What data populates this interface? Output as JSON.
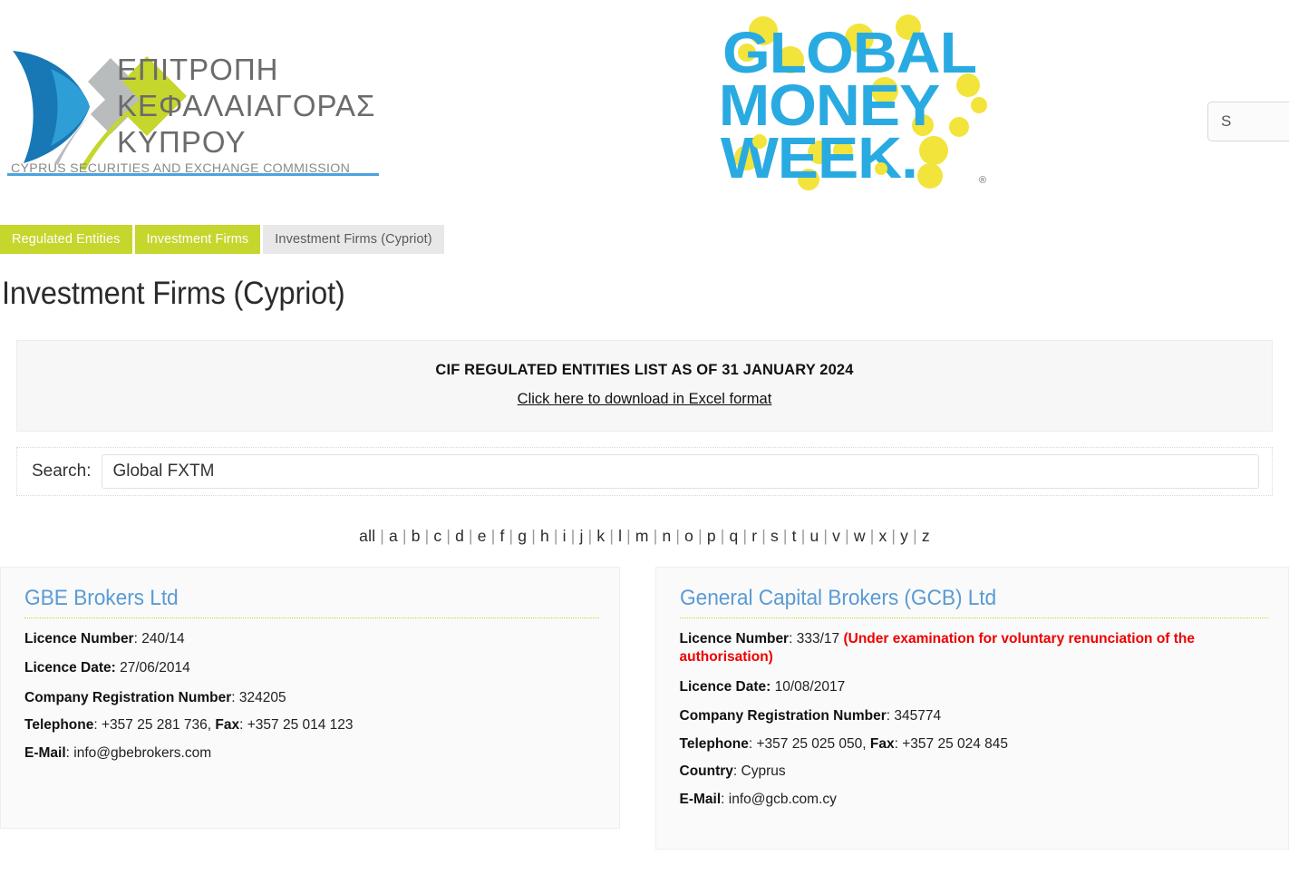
{
  "header": {
    "cysec_logo_alt": "ΕΠΙΤΡΟΠΗ ΚΕΦΑΛΑΙΑΓΟΡΑΣ ΚΥΠΡΟΥ",
    "cysec_line1": "ΕΠΙΤΡΟΠΗ",
    "cysec_line2": "ΚΕΦΑΛΑΙΑΓΟΡΑΣ",
    "cysec_line3": "ΚΥΠΡΟΥ",
    "cysec_subtitle": "CYPRUS SECURITIES AND EXCHANGE COMMISSION",
    "gmw_line1": "GLOBAL",
    "gmw_line2": "MONEY",
    "gmw_line3": "WEEK",
    "search_value": "S"
  },
  "breadcrumb": {
    "items": [
      {
        "label": "Regulated Entities",
        "state": "link"
      },
      {
        "label": "Investment Firms",
        "state": "link"
      },
      {
        "label": "Investment Firms (Cypriot)",
        "state": "current"
      }
    ]
  },
  "page": {
    "title": "Investment Firms (Cypriot)"
  },
  "notice": {
    "title": "CIF REGULATED ENTITIES LIST AS OF 31 JANUARY 2024",
    "link": "Click here to download in Excel format"
  },
  "search": {
    "label": "Search:",
    "value": "Global FXTM",
    "placeholder": ""
  },
  "alpha_filter": {
    "items": [
      "all",
      "a",
      "b",
      "c",
      "d",
      "e",
      "f",
      "g",
      "h",
      "i",
      "j",
      "k",
      "l",
      "m",
      "n",
      "o",
      "p",
      "q",
      "r",
      "s",
      "t",
      "u",
      "v",
      "w",
      "x",
      "y",
      "z"
    ],
    "separator": "|"
  },
  "results": [
    {
      "name": "GBE Brokers Ltd",
      "licence_number_label": "Licence Number",
      "licence_number": "240/14",
      "licence_status": "",
      "licence_date_label": "Licence Date:",
      "licence_date": "27/06/2014",
      "company_reg_label": "Company Registration Number",
      "company_reg": "324205",
      "telephone_label": "Telephone",
      "telephone": "+357 25 281 736",
      "fax_label": "Fax",
      "fax": "+357 25 014 123",
      "country_label": "",
      "country": "",
      "email_label": "E-Mail",
      "email": "info@gbebrokers.com"
    },
    {
      "name": "General Capital Brokers (GCB) Ltd",
      "licence_number_label": "Licence Number",
      "licence_number": "333/17",
      "licence_status": "(Under examination for voluntary renunciation of the authorisation)",
      "licence_date_label": "Licence Date:",
      "licence_date": "10/08/2017",
      "company_reg_label": "Company Registration Number",
      "company_reg": "345774",
      "telephone_label": "Telephone",
      "telephone": "+357 25 025 050",
      "fax_label": "Fax",
      "fax": "+357 25 024 845",
      "country_label": "Country",
      "country": "Cyprus",
      "email_label": "E-Mail",
      "email": "info@gcb.com.cy"
    }
  ],
  "colors": {
    "brand_green": "#c5d62c",
    "link_blue": "#5b9bd5",
    "warning_red": "#ee0000",
    "gmw_blue": "#29abe2",
    "gmw_yellow": "#f7e832"
  }
}
